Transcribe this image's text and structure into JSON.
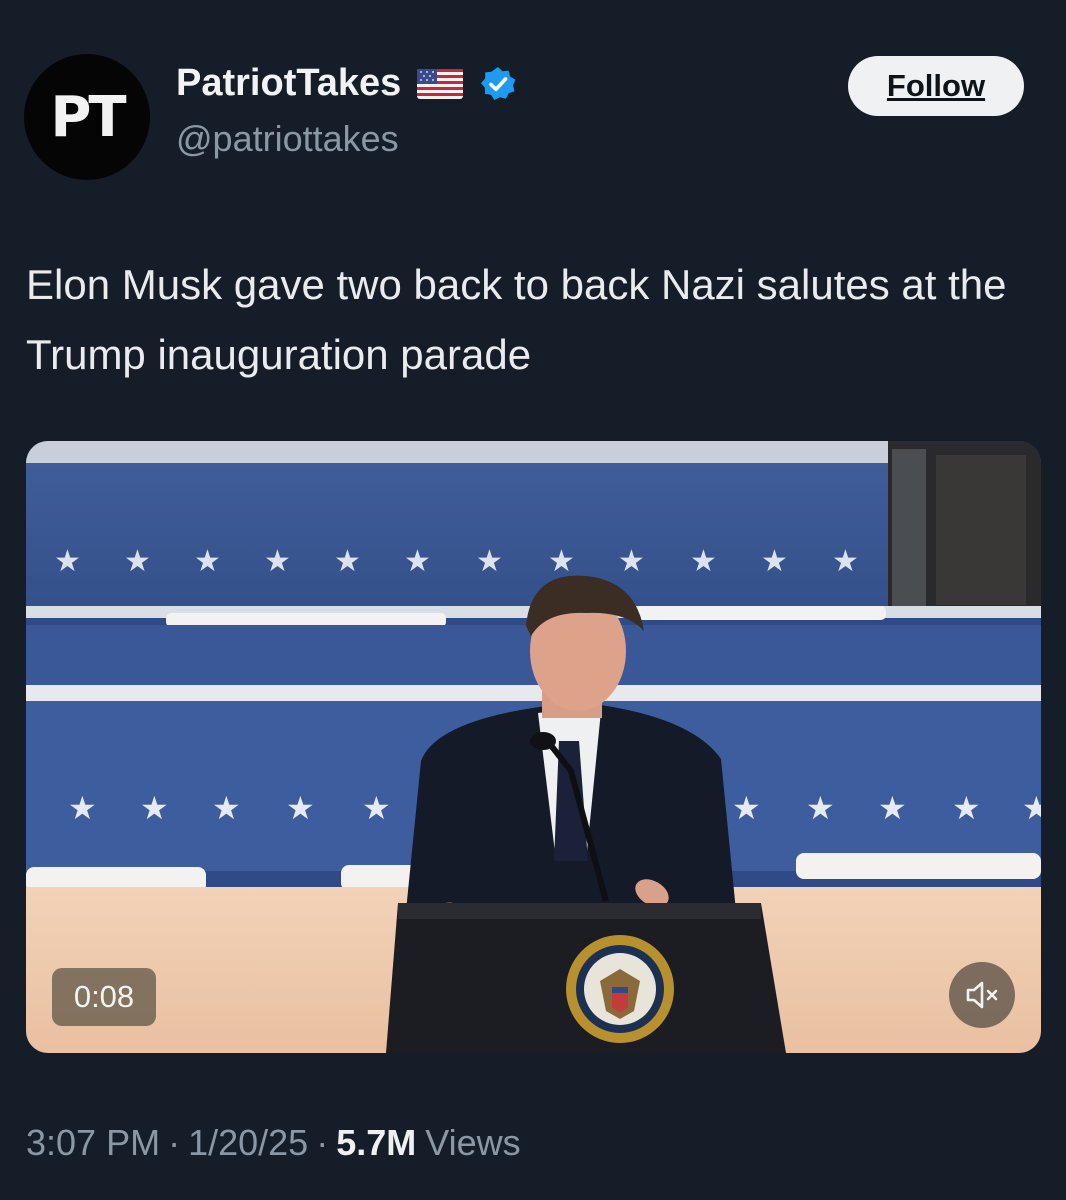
{
  "account": {
    "avatar_text": "PT",
    "display_name": "PatriotTakes",
    "flag_icon": "us-flag-icon",
    "verified_icon": "verified-badge-icon",
    "handle": "@patriottakes"
  },
  "follow_label": "Follow",
  "tweet": {
    "text": "Elon Musk gave two back to back Nazi salutes at the Trump inauguration parade"
  },
  "media": {
    "type": "video",
    "duration": "0:08",
    "mute_icon": "volume-muted-icon"
  },
  "meta": {
    "time": "3:07 PM",
    "date": "1/20/25",
    "separator": "·",
    "views_count": "5.7M",
    "views_label": "Views"
  },
  "colors": {
    "background": "#151d28",
    "text": "#e7e9ea",
    "secondary_text": "#8a98a5",
    "verified_blue": "#1d9bf0",
    "follow_bg": "#eff1f3"
  }
}
